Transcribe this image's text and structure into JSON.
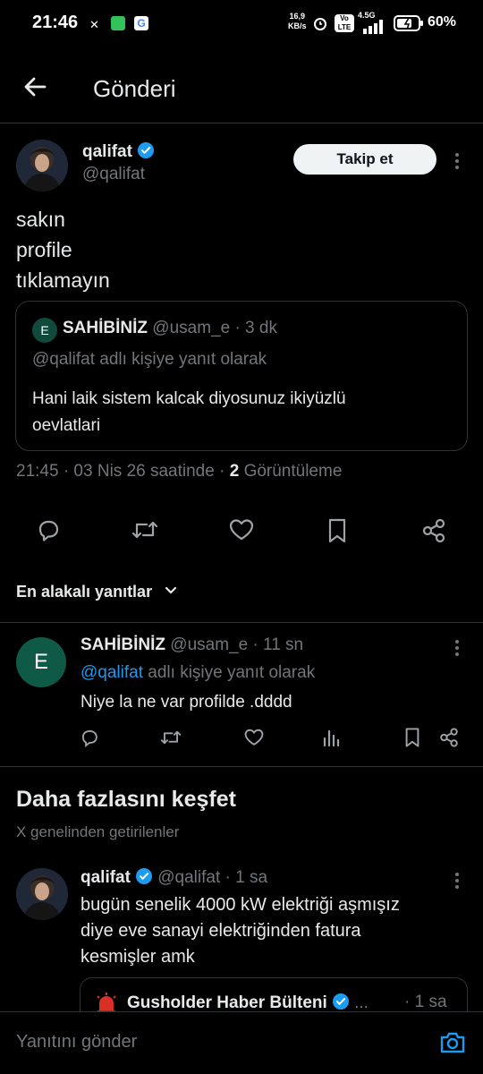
{
  "status_bar": {
    "time": "21:46",
    "speed_value": "16,9",
    "speed_unit": "KB/s",
    "network": "4.5G",
    "battery": "60%"
  },
  "header": {
    "title": "Gönderi"
  },
  "post": {
    "author_name": "qalifat",
    "author_handle": "@qalifat",
    "follow_label": "Takip et",
    "text_lines": [
      "sakın",
      "profile",
      "tıklamayın"
    ],
    "quote": {
      "avatar_letter": "E",
      "name": "SAHİBİNİZ",
      "handle": "@usam_e",
      "time": "· 3 dk",
      "reply_context": "@qalifat adlı kişiye yanıt olarak",
      "text_lines": [
        "Hani laik sistem kalcak diyosunuz ikiyüzlü",
        "oevlatlari"
      ]
    },
    "meta_time": "21:45 · 03 Nis 26 saatinde ·",
    "views_count": "2",
    "views_label": "Görüntüleme"
  },
  "replies_sort": {
    "label": "En alakalı yanıtlar"
  },
  "reply": {
    "avatar_letter": "E",
    "name": "SAHİBİNİZ",
    "handle": "@usam_e",
    "time": "· 11 sn",
    "context_mention": "@qalifat",
    "context_rest": "adlı kişiye yanıt olarak",
    "text": "Niye la ne var profilde .dddd"
  },
  "explore": {
    "title": "Daha fazlasını keşfet",
    "subtitle": "X genelinden getirilenler"
  },
  "explore_post": {
    "author_name": "qalifat",
    "author_handle": "@qalifat",
    "time": "· 1 sa",
    "text_lines": [
      "bugün senelik 4000 kW elektriği aşmışız",
      "diye eve sanayi elektriğinden fatura",
      "kesmişler amk"
    ],
    "quote_name": "Gusholder Haber Bülteni",
    "quote_time": "· 1 sa"
  },
  "reply_bar": {
    "placeholder": "Yanıtını gönder"
  },
  "colors": {
    "background": "#000000",
    "text": "#e7e9ea",
    "muted": "#71767b",
    "accent": "#1d9bf0",
    "border": "#2f3336"
  }
}
